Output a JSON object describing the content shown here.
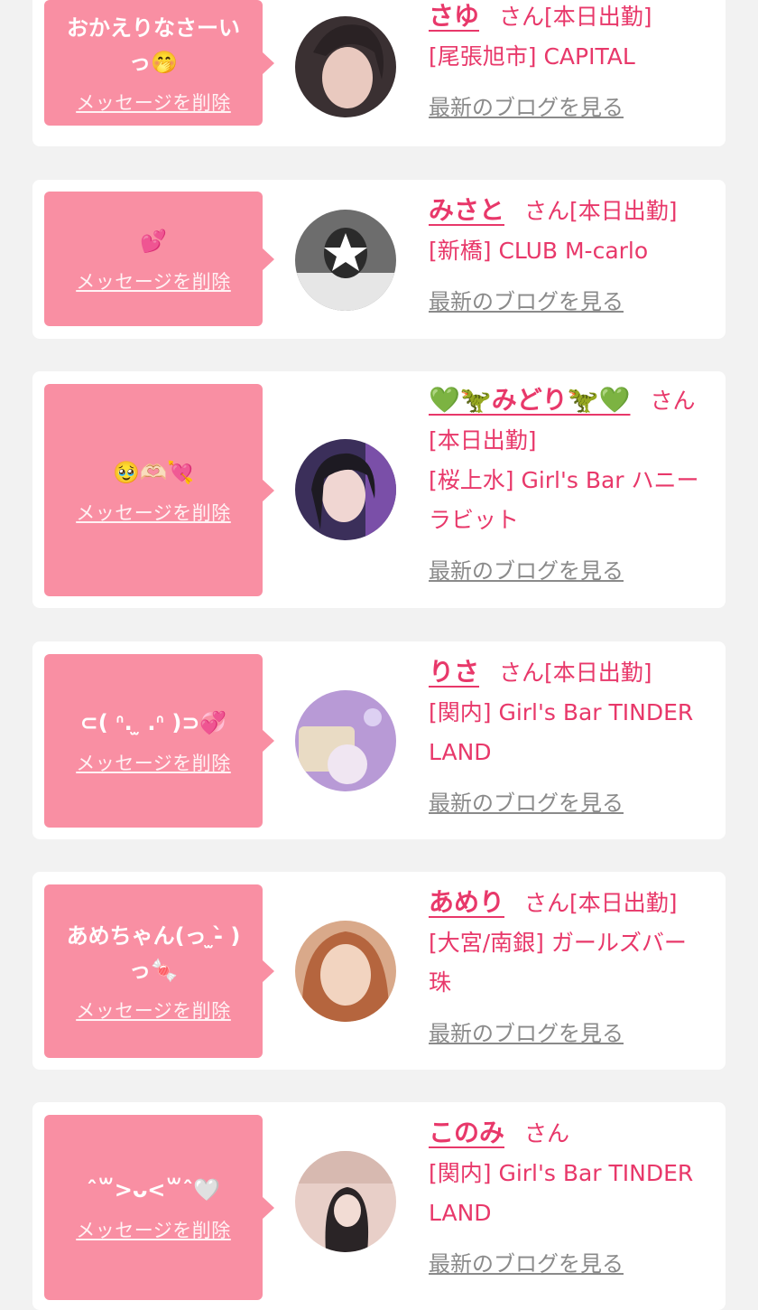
{
  "common": {
    "delete_label": "メッセージを削除",
    "blog_label": "最新のブログを見る",
    "colors": {
      "accent": "#e8386a",
      "bubble": "#f98fa3",
      "muted": "#8a8a8a",
      "background": "#f2f2f2"
    }
  },
  "cards": [
    {
      "message": "おかえりなさーい\nっ🤭",
      "name": "さゆ",
      "suffix": "さん[本日出勤]",
      "shop": "[尾張旭市] CAPITAL"
    },
    {
      "message": "💕",
      "name": "みさと",
      "suffix": "さん[本日出勤]",
      "shop": "[新橋] CLUB M-carlo"
    },
    {
      "message": "🥹🫶🏻💘",
      "name": "💚🦖みどり🦖💚",
      "suffix": "さん[本日出勤]",
      "shop": "[桜上水] Girl's Bar ハニーラビット"
    },
    {
      "message": "⊂( ᐢ. ̫ .ᐢ )⊃💞",
      "name": "りさ",
      "suffix": "さん[本日出勤]",
      "shop": "[関内] Girl's Bar TINDER LAND"
    },
    {
      "message": "あめちゃん(っ ̫-̀ )\nっ🍬",
      "name": "あめり",
      "suffix": "さん[本日出勤]",
      "shop": "[大宮/南銀] ガールズバー 珠"
    },
    {
      "message": "ˆ꒳>ᴗ<꒳ˆ🤍",
      "name": "このみ",
      "suffix": "さん",
      "shop": "[関内] Girl's Bar TINDER LAND"
    }
  ]
}
